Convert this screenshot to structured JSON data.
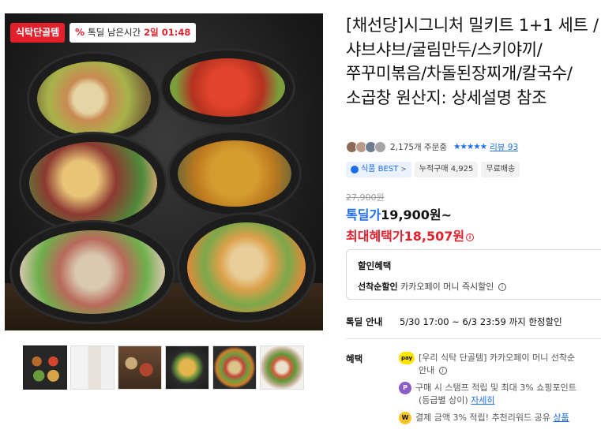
{
  "image": {
    "badge_left": "식탁단골템",
    "timer_prefix_icon": "%",
    "timer_label": "톡딜 남은시간",
    "timer_value": "2일 01:48"
  },
  "product": {
    "title": "[채선당]시그니처 밀키트 1+1 세트 /샤브샤브/굴림만두/스키야끼/쭈꾸미볶음/차돌된장찌개/칼국수/소곱창 원산지: 상세설명 참조",
    "orders": "2,175개 주문중",
    "stars": "★★★★★",
    "review": "리뷰 93",
    "tags": {
      "best": "식품 BEST",
      "best_arrow": ">",
      "purchases": "누적구매 4,925",
      "shipping": "무료배송"
    },
    "original_price": "27,900원",
    "deal_label": "톡딜가",
    "deal_price": "19,900원~",
    "max_benefit_label": "최대혜택가",
    "max_benefit_price": "18,507원",
    "info_glyph": "i"
  },
  "discount": {
    "heading": "할인혜택",
    "first_label": "선착순할인",
    "first_desc": "카카오페이 머니 즉시할인",
    "info_glyph": "i"
  },
  "deal_info": {
    "label": "톡딜 안내",
    "period": "5/30 17:00 ~ 6/3 23:59 까지 한정할인"
  },
  "benefits": {
    "label": "혜택",
    "item1_icon": "pay",
    "item1_line1": "[우리 식탁 단골템] 카카오페이 머니 선착순",
    "item1_line2": "안내",
    "item2_icon": "P",
    "item2_line1": "구매 시 스탬프 적립 및 최대 3% 쇼핑포인트",
    "item2_line2": "(등급별 상이)",
    "item2_link": "자세히",
    "item3_icon": "W",
    "item3_line1": "결제 금액 3% 적립! 추천리워드 공유",
    "item3_link": "상품"
  }
}
